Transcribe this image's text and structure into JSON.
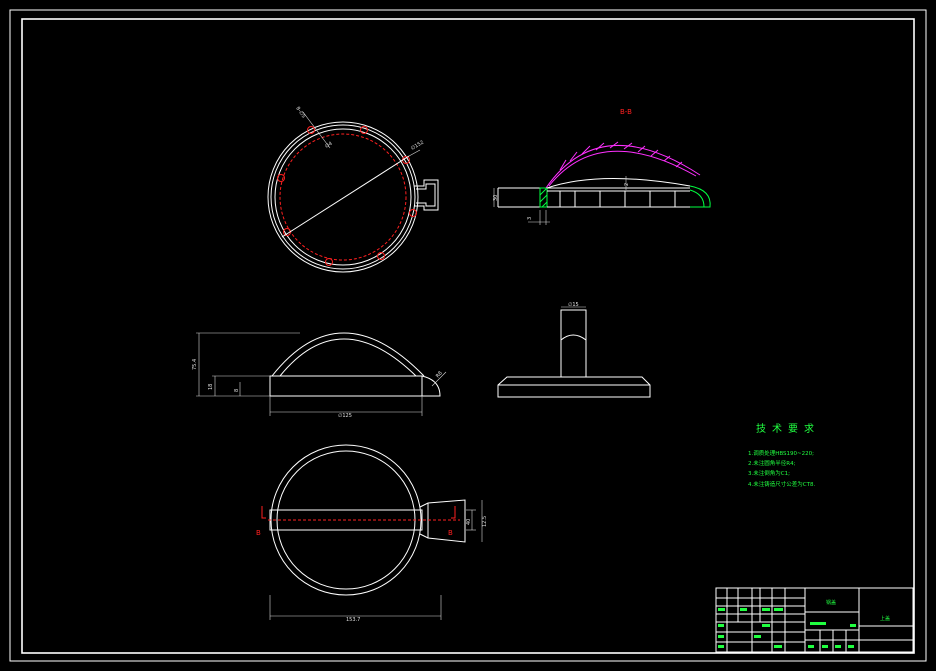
{
  "drawing": {
    "section_label": "B-B",
    "cut_marks": {
      "left": "B",
      "right": "B"
    },
    "dimensions": {
      "hole_pattern": "8-∅5",
      "hole_callout": "∅4",
      "diameter_large": "∅152",
      "section_height": "30",
      "section_inner": "3",
      "section_small": "2",
      "side_height": "75.4",
      "side_base": "18",
      "side_flange": "8",
      "side_radius": "R8",
      "side_width": "∅125",
      "stem_top": "∅15",
      "bottom_width": "153.7",
      "handle_inner": "40",
      "handle_outer": "12.5"
    },
    "tech_requirements": {
      "title": "技术要求",
      "items": [
        "1.调质处理HBS190~220;",
        "2.未注圆角半径R4;",
        "3.未注倒角为C1;",
        "4.未注铸造尺寸公差为CT8."
      ]
    },
    "title_block": {
      "part_name": "锅盖",
      "drawing_name": "上盖"
    }
  }
}
